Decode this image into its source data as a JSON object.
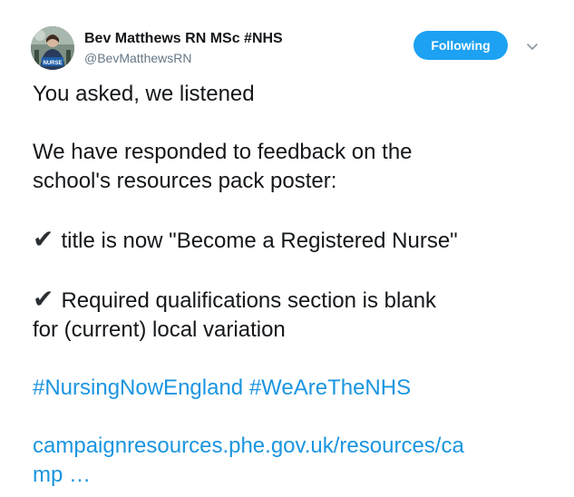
{
  "author": {
    "display_name": "Bev Matthews RN MSc #NHS",
    "handle": "@BevMatthewsRN",
    "avatar_badge_text": "NURSE",
    "avatar_icon": "profile-photo"
  },
  "actions": {
    "follow_label": "Following",
    "menu_icon": "chevron-down-icon"
  },
  "tweet": {
    "line1": "You asked, we listened",
    "para2_line1": "We have responded to feedback on the",
    "para2_line2": "school's resources pack poster:",
    "check_glyph": "✔",
    "item1": "title is now \"Become a Registered Nurse\"",
    "item2_line1": "Required qualifications section is blank",
    "item2_line2": "for (current) local variation",
    "hashtag1": "#NursingNowEngland",
    "hashtag2": "#WeAreTheNHS",
    "url_line1": "campaignresources.phe.gov.uk/resources/ca",
    "url_line2": "mp …"
  },
  "colors": {
    "link": "#1b95e0",
    "button_bg": "#1da1f2",
    "handle_gray": "#657786"
  }
}
